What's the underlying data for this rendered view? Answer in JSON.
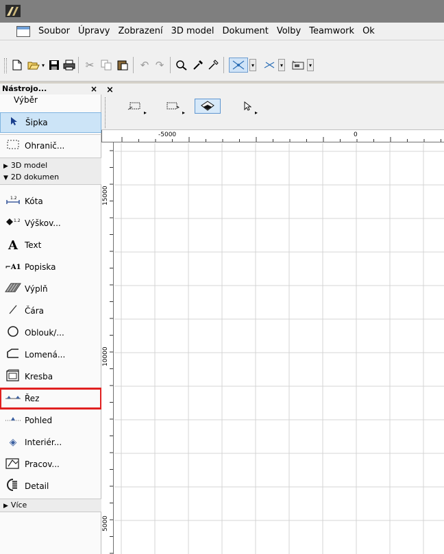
{
  "menubar": {
    "items": [
      "Soubor",
      "Úpravy",
      "Zobrazení",
      "3D model",
      "Dokument",
      "Volby",
      "Teamwork",
      "Ok"
    ]
  },
  "panel": {
    "title": "Nástrojo...",
    "close": "×",
    "vyber_label": "Výběr",
    "tools_top": [
      {
        "label": "Šipka",
        "icon": "arrow-pointer-icon"
      },
      {
        "label": "Ohranič...",
        "icon": "marquee-icon"
      }
    ],
    "groups": {
      "model": "3D model",
      "doc": "2D dokumen",
      "more": "Více"
    },
    "tools_doc": [
      {
        "label": "Kóta",
        "icon": "dimension-icon",
        "glyph": "1.2"
      },
      {
        "label": "Výškov...",
        "icon": "level-dimension-icon",
        "glyph": "1.2"
      },
      {
        "label": "Text",
        "icon": "text-icon",
        "glyph": "A"
      },
      {
        "label": "Popiska",
        "icon": "label-icon",
        "glyph": "A1"
      },
      {
        "label": "Výplň",
        "icon": "fill-icon"
      },
      {
        "label": "Čára",
        "icon": "line-icon",
        "glyph": "╱"
      },
      {
        "label": "Oblouk/...",
        "icon": "arc-circle-icon",
        "glyph": "○"
      },
      {
        "label": "Lomená...",
        "icon": "polyline-icon"
      },
      {
        "label": "Kresba",
        "icon": "drawing-icon"
      },
      {
        "label": "Řez",
        "icon": "section-icon"
      },
      {
        "label": "Pohled",
        "icon": "elevation-icon"
      },
      {
        "label": "Interiér...",
        "icon": "interior-elevation-icon",
        "glyph": "◈"
      },
      {
        "label": "Pracov...",
        "icon": "worksheet-icon"
      },
      {
        "label": "Detail",
        "icon": "detail-icon"
      }
    ]
  },
  "infobox": {
    "close": "×"
  },
  "ruler": {
    "top_labels": [
      "-5000",
      "0"
    ],
    "left_labels": [
      "15000",
      "10000",
      "5000"
    ]
  }
}
